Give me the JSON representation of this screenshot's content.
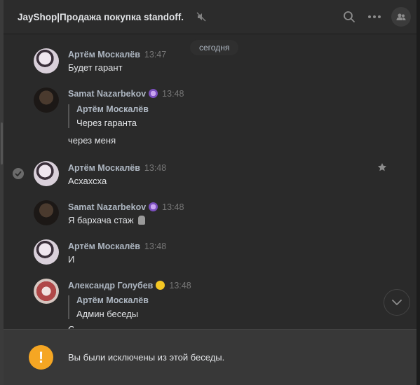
{
  "header": {
    "title": "JayShop|Продажа покупка standoff.",
    "icons": [
      "mute-icon",
      "search-icon",
      "more-icon",
      "members-icon"
    ]
  },
  "feed": {
    "date_label": "сегодня",
    "messages": [
      {
        "author": "Артём Москалёв",
        "time": "13:47",
        "text": "Будет гарант"
      },
      {
        "author": "Samat Nazarbekov",
        "time": "13:48",
        "quote_author": "Артём Москалёв",
        "quote_text": "Через гаранта",
        "text": "через меня"
      },
      {
        "author": "Артём Москалёв",
        "time": "13:48",
        "text": "Асхахсха"
      },
      {
        "author": "Samat Nazarbekov",
        "time": "13:48",
        "text": "Я бархача стаж"
      },
      {
        "author": "Артём Москалёв",
        "time": "13:48",
        "text": "И"
      },
      {
        "author": "Александр Голубев",
        "time": "13:48",
        "quote_author": "Артём Москалёв",
        "quote_text": "Админ беседы",
        "text": "С"
      }
    ]
  },
  "banner": {
    "icon_symbol": "!",
    "text": "Вы были исключены из этой беседы."
  },
  "colors": {
    "background": "#2a2a2a",
    "warning": "#f5a623",
    "name": "#aeb7c2"
  }
}
